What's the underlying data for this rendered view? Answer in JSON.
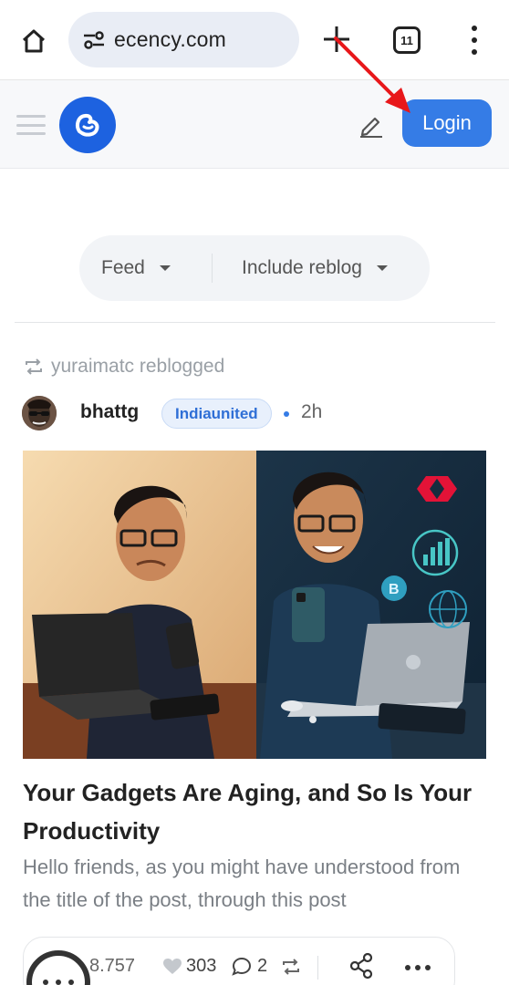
{
  "browser": {
    "url": "ecency.com",
    "tab_count": "11"
  },
  "header": {
    "login_label": "Login"
  },
  "filters": {
    "feed_label": "Feed",
    "reblog_label": "Include reblog"
  },
  "post": {
    "reblogged_by": "yuraimatc reblogged",
    "author": "bhattg",
    "community": "Indiaunited",
    "time": "2h",
    "title": "Your Gadgets Are Aging, and So Is Your Productivity",
    "excerpt": "Hello friends, as you might have understood from the title of the post, through this post",
    "payout": "8.757",
    "votes": "303",
    "comments": "2"
  },
  "colors": {
    "accent": "#357ce6",
    "logo": "#1d62e0",
    "annotation_arrow": "#e8171a"
  },
  "icons": [
    "home-icon",
    "tune-icon",
    "plus-icon",
    "tabs-icon",
    "more-vert-icon",
    "hamburger-icon",
    "ecency-logo-icon",
    "pencil-icon",
    "reblog-icon",
    "heart-icon",
    "comment-icon",
    "share-icon",
    "more-horiz-icon"
  ]
}
